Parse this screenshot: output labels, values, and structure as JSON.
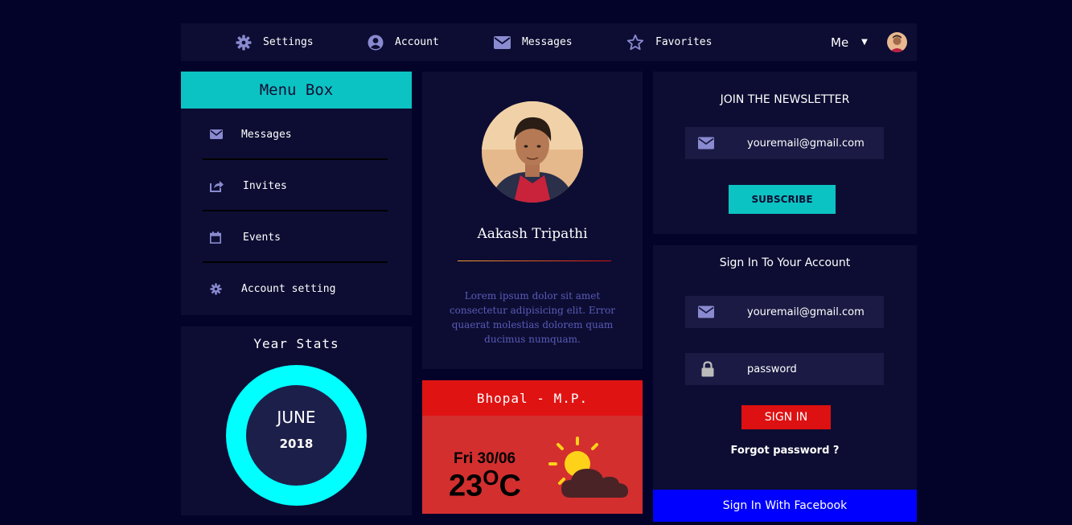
{
  "nav": {
    "items": [
      {
        "label": "Settings",
        "icon": "gear-icon"
      },
      {
        "label": "Account",
        "icon": "user-circle-icon"
      },
      {
        "label": "Messages",
        "icon": "envelope-icon"
      },
      {
        "label": "Favorites",
        "icon": "star-icon"
      }
    ],
    "user_label": "Me",
    "caret": "▼"
  },
  "menu": {
    "title": "Menu Box",
    "items": [
      {
        "label": "Messages",
        "icon": "envelope-icon"
      },
      {
        "label": "Invites",
        "icon": "share-icon"
      },
      {
        "label": "Events",
        "icon": "calendar-icon"
      },
      {
        "label": "Account setting",
        "icon": "gear-icon"
      }
    ]
  },
  "stats": {
    "title": "Year Stats",
    "month": "JUNE",
    "year": "2018"
  },
  "profile": {
    "name": "Aakash Tripathi",
    "bio": "Lorem ipsum dolor sit amet consectetur adipisicing elit. Error quaerat molestias dolorem quam ducimus numquam."
  },
  "weather": {
    "city": "Bhopal - M.P.",
    "date": "Fri 30/06",
    "temp": "23",
    "unit": "O",
    "unit_suffix": "C",
    "icon": "partly-cloudy-icon"
  },
  "newsletter": {
    "title": "JOIN THE NEWSLETTER",
    "email_value": "youremail@gmail.com",
    "button": "SUBSCRIBE"
  },
  "signin": {
    "title": "Sign In To Your Account",
    "email_value": "youremail@gmail.com",
    "password_value": "password",
    "button": "SIGN IN",
    "forgot": "Forgot password ?",
    "facebook": "Sign In With Facebook"
  },
  "colors": {
    "background": "#03032a",
    "panel": "#0d0d33",
    "accent": "#0cc3c3",
    "ring": "#00ffff",
    "danger": "#e01313",
    "facebook": "#0000ff"
  }
}
